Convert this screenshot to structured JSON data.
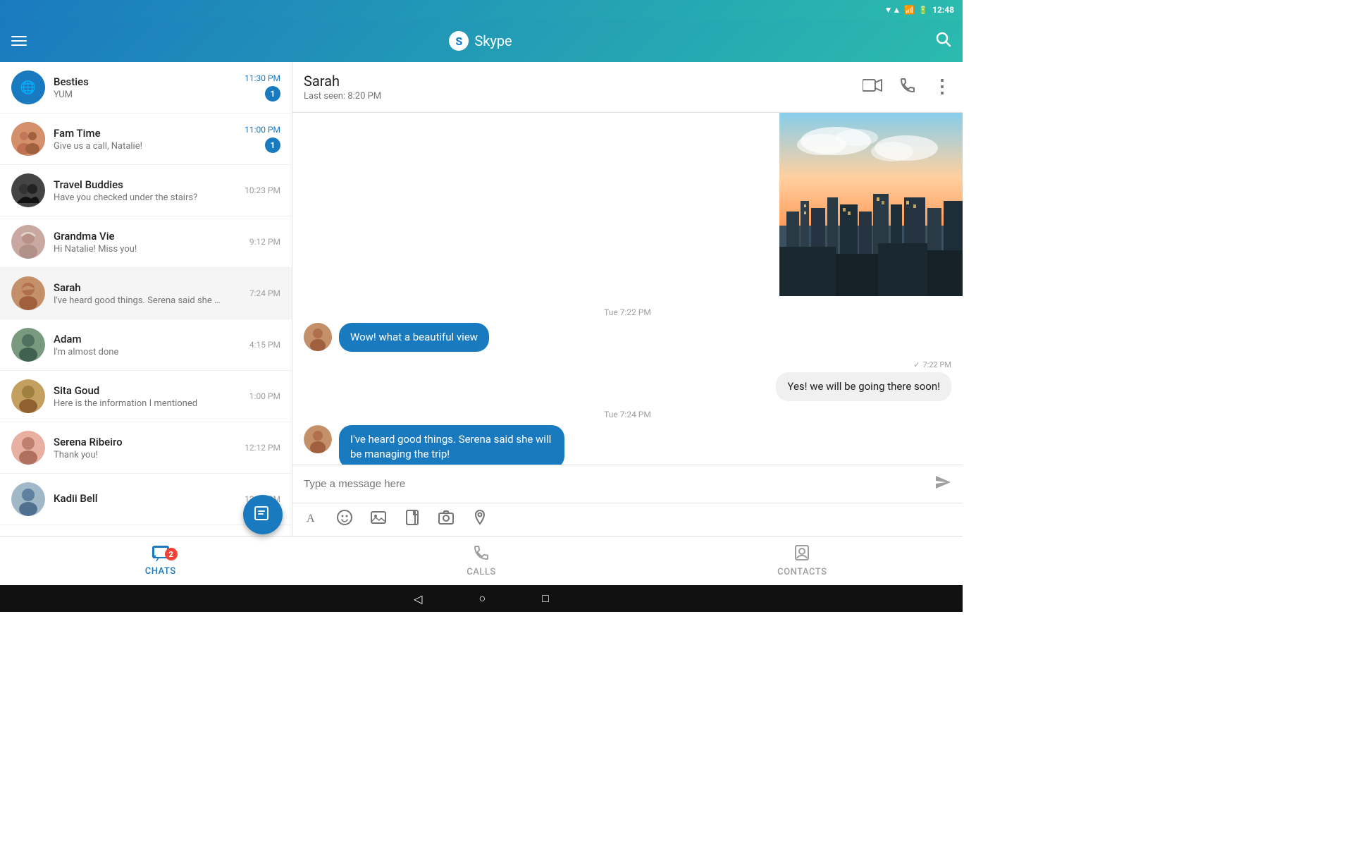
{
  "statusBar": {
    "time": "12:48",
    "icons": [
      "wifi",
      "signal",
      "battery"
    ]
  },
  "appBar": {
    "title": "Skype",
    "logoLetter": "S"
  },
  "chatList": {
    "items": [
      {
        "id": "besties",
        "name": "Besties",
        "preview": "YUM",
        "time": "11:30 PM",
        "badge": "1",
        "timeHighlight": true
      },
      {
        "id": "famtime",
        "name": "Fam Time",
        "preview": "Give us a call, Natalie!",
        "time": "11:00 PM",
        "badge": "1",
        "timeHighlight": true
      },
      {
        "id": "travel",
        "name": "Travel Buddies",
        "preview": "Have you checked under the stairs?",
        "time": "10:23 PM",
        "badge": "",
        "timeHighlight": false
      },
      {
        "id": "grandma",
        "name": "Grandma Vie",
        "preview": "Hi Natalie! Miss you!",
        "time": "9:12 PM",
        "badge": "",
        "timeHighlight": false
      },
      {
        "id": "sarah",
        "name": "Sarah",
        "preview": "I've heard good things. Serena said she will…",
        "time": "7:24 PM",
        "badge": "",
        "timeHighlight": false,
        "active": true
      },
      {
        "id": "adam",
        "name": "Adam",
        "preview": "I'm almost done",
        "time": "4:15 PM",
        "badge": "",
        "timeHighlight": false
      },
      {
        "id": "sita",
        "name": "Sita Goud",
        "preview": "Here is the information I mentioned",
        "time": "1:00 PM",
        "badge": "",
        "timeHighlight": false
      },
      {
        "id": "serena",
        "name": "Serena Ribeiro",
        "preview": "Thank you!",
        "time": "12:12 PM",
        "badge": "",
        "timeHighlight": false
      },
      {
        "id": "kadii",
        "name": "Kadii Bell",
        "preview": "",
        "time": "12:05 PM",
        "badge": "",
        "timeHighlight": false
      }
    ]
  },
  "conversation": {
    "name": "Sarah",
    "status": "Last seen: 8:20 PM",
    "messages": [
      {
        "id": "msg1",
        "type": "received",
        "timestamp": "Tue 7:22 PM",
        "text": "Wow! what a beautiful view",
        "showTimestamp": true
      },
      {
        "id": "msg2",
        "type": "sent",
        "timestamp": "7:22 PM",
        "text": "Yes! we will be going there soon!",
        "showTimestamp": false
      },
      {
        "id": "msg3",
        "type": "received",
        "timestamp": "Tue 7:24 PM",
        "text": "I've heard good things. Serena said she will be managing the trip!",
        "showTimestamp": true
      }
    ],
    "inputPlaceholder": "Type a message here"
  },
  "bottomNav": {
    "items": [
      {
        "id": "chats",
        "label": "CHATS",
        "icon": "💬",
        "badge": "2",
        "active": true
      },
      {
        "id": "calls",
        "label": "CALLS",
        "icon": "📞",
        "badge": "",
        "active": false
      },
      {
        "id": "contacts",
        "label": "CONTACTS",
        "icon": "👤",
        "badge": "",
        "active": false
      }
    ]
  },
  "androidNav": {
    "back": "◁",
    "home": "○",
    "recents": "□"
  }
}
